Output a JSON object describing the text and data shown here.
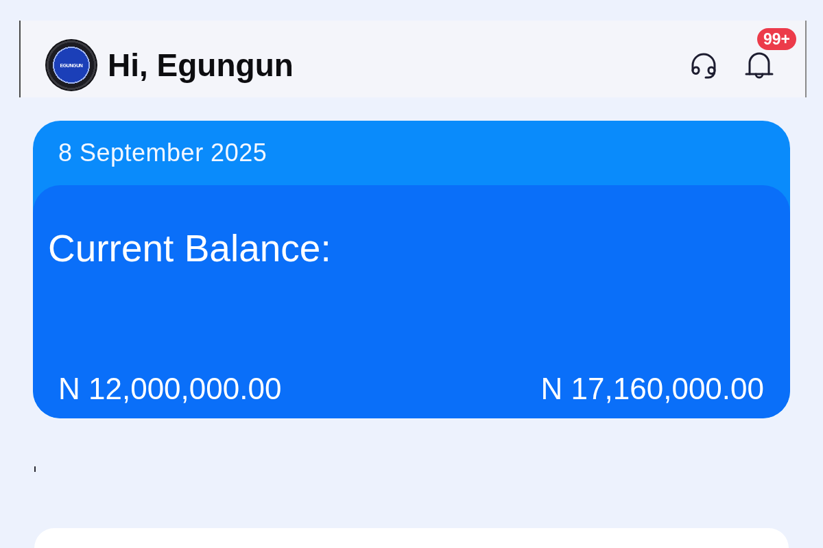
{
  "header": {
    "avatar": {
      "label": "EGUNGUN"
    },
    "greeting": "Hi, Egungun",
    "notifications": {
      "badge": "99+"
    }
  },
  "balance_card": {
    "date": "8 September 2025",
    "title": "Current Balance:",
    "amounts": [
      "N 12,000,000.00",
      "N 17,160,000.00"
    ]
  }
}
